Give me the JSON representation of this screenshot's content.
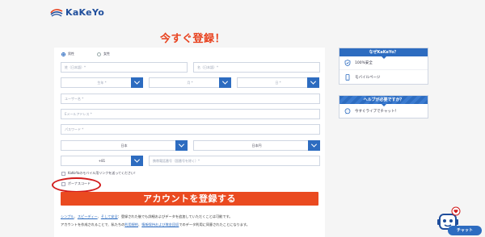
{
  "brand": {
    "logo_text": "KaKeYo"
  },
  "headline": "今すぐ登録！",
  "form": {
    "gender_options": [
      "男性",
      "女性"
    ],
    "last_name_placeholder": "姓（日本語）*",
    "first_name_placeholder": "名（日本語）*",
    "birth_year_placeholder": "生年 *",
    "birth_month_placeholder": "月 *",
    "birth_day_placeholder": "日 *",
    "username_placeholder": "ユーザー名 *",
    "email_placeholder": "Eメールアドレス *",
    "password_placeholder": "パスワード *",
    "country_value": "日本",
    "currency_value": "日本円",
    "phone_code_value": "+81",
    "phone_placeholder": "携帯電話番号（国番号を除く）*",
    "sms_checkbox_label": "KaKeYoのモバイル用リンクを送ってください！",
    "bonus_code_label": "ボーナスコード",
    "submit_label": "アカウントを登録する"
  },
  "terms": {
    "line1_links": [
      "シンプル",
      "スピーディー",
      "そして安全"
    ],
    "line1_seps": [
      "、",
      "、"
    ],
    "line1_rest": "：登録された後でも詳細およびデータを追加していただくことは可能です。",
    "line2_prefix": "アカウントを作成されることで、私たちの",
    "line2_link1": "利用規約",
    "line2_mid": "、",
    "line2_link2": "情報保持および賞金回収",
    "line2_suffix": "でのデータ利用に同意されたことになります。"
  },
  "sidebar": {
    "why_title": "なぜKaKeYo？",
    "why_items": [
      {
        "icon": "shield-icon",
        "label": "100%安全"
      },
      {
        "icon": "mobile-icon",
        "label": "モバイルページ"
      }
    ],
    "help_title": "ヘルプが必要ですか？",
    "help_items": [
      {
        "icon": "chat-icon",
        "label": "今すぐライブでチャット！"
      }
    ]
  },
  "chat": {
    "button_label": "チャット"
  },
  "colors": {
    "brand_blue": "#2d6cc0",
    "cta_orange": "#ea4a20",
    "headline_red": "#e8401c",
    "highlight_red": "#d21c1c"
  }
}
